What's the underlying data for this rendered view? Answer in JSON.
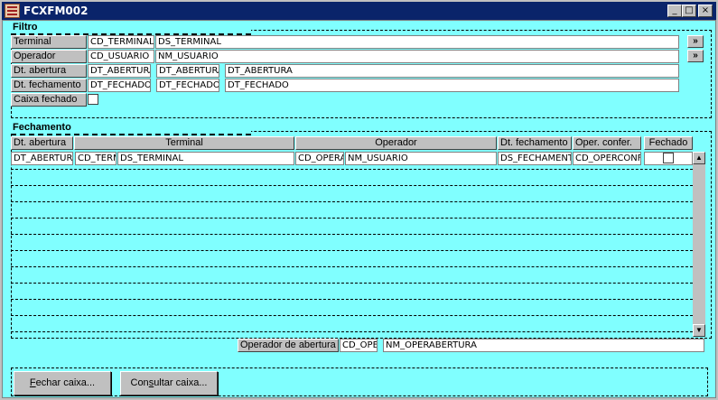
{
  "window": {
    "title": "FCXFM002",
    "minimize": "_",
    "maximize": "□",
    "close": "×"
  },
  "filtro": {
    "title": "Filtro",
    "terminal": {
      "label": "Terminal",
      "code": "CD_TERMINAL",
      "desc": "DS_TERMINAL",
      "lookup": "»"
    },
    "operador": {
      "label": "Operador",
      "code": "CD_USUARIO",
      "desc": "NM_USUARIO",
      "lookup": "»"
    },
    "dt_abertura": {
      "label": "Dt. abertura",
      "from": "DT_ABERTURA",
      "to": "DT_ABERTURA",
      "desc": "DT_ABERTURA"
    },
    "dt_fechamento": {
      "label": "Dt. fechamento",
      "from": "DT_FECHADO",
      "to": "DT_FECHADO",
      "desc": "DT_FECHADO"
    },
    "caixa_fechado": {
      "label": "Caixa fechado"
    }
  },
  "fechamento": {
    "title": "Fechamento",
    "columns": [
      "Dt. abertura",
      "Terminal",
      "Operador",
      "Dt. fechamento",
      "Oper. confer.",
      "Fechado"
    ],
    "row": {
      "dt_abertura": "DT_ABERTURA",
      "cd_terminal": "CD_TERMINAL",
      "ds_terminal": "DS_TERMINAL",
      "cd_operador": "CD_OPERADOR",
      "nm_usuario": "NM_USUARIO",
      "ds_fechamento": "DS_FECHAMENTO",
      "cd_operconf": "CD_OPERCONF"
    },
    "scroll_up": "▲",
    "scroll_down": "▼",
    "operador_abertura": {
      "label": "Operador de abertura",
      "code": "CD_OPERADOR",
      "name": "NM_OPERABERTURA"
    }
  },
  "buttons": {
    "fechar_underline": "F",
    "fechar_rest": "echar caixa...",
    "consultar_pre": "Con",
    "consultar_underline": "s",
    "consultar_rest": "ultar caixa..."
  }
}
